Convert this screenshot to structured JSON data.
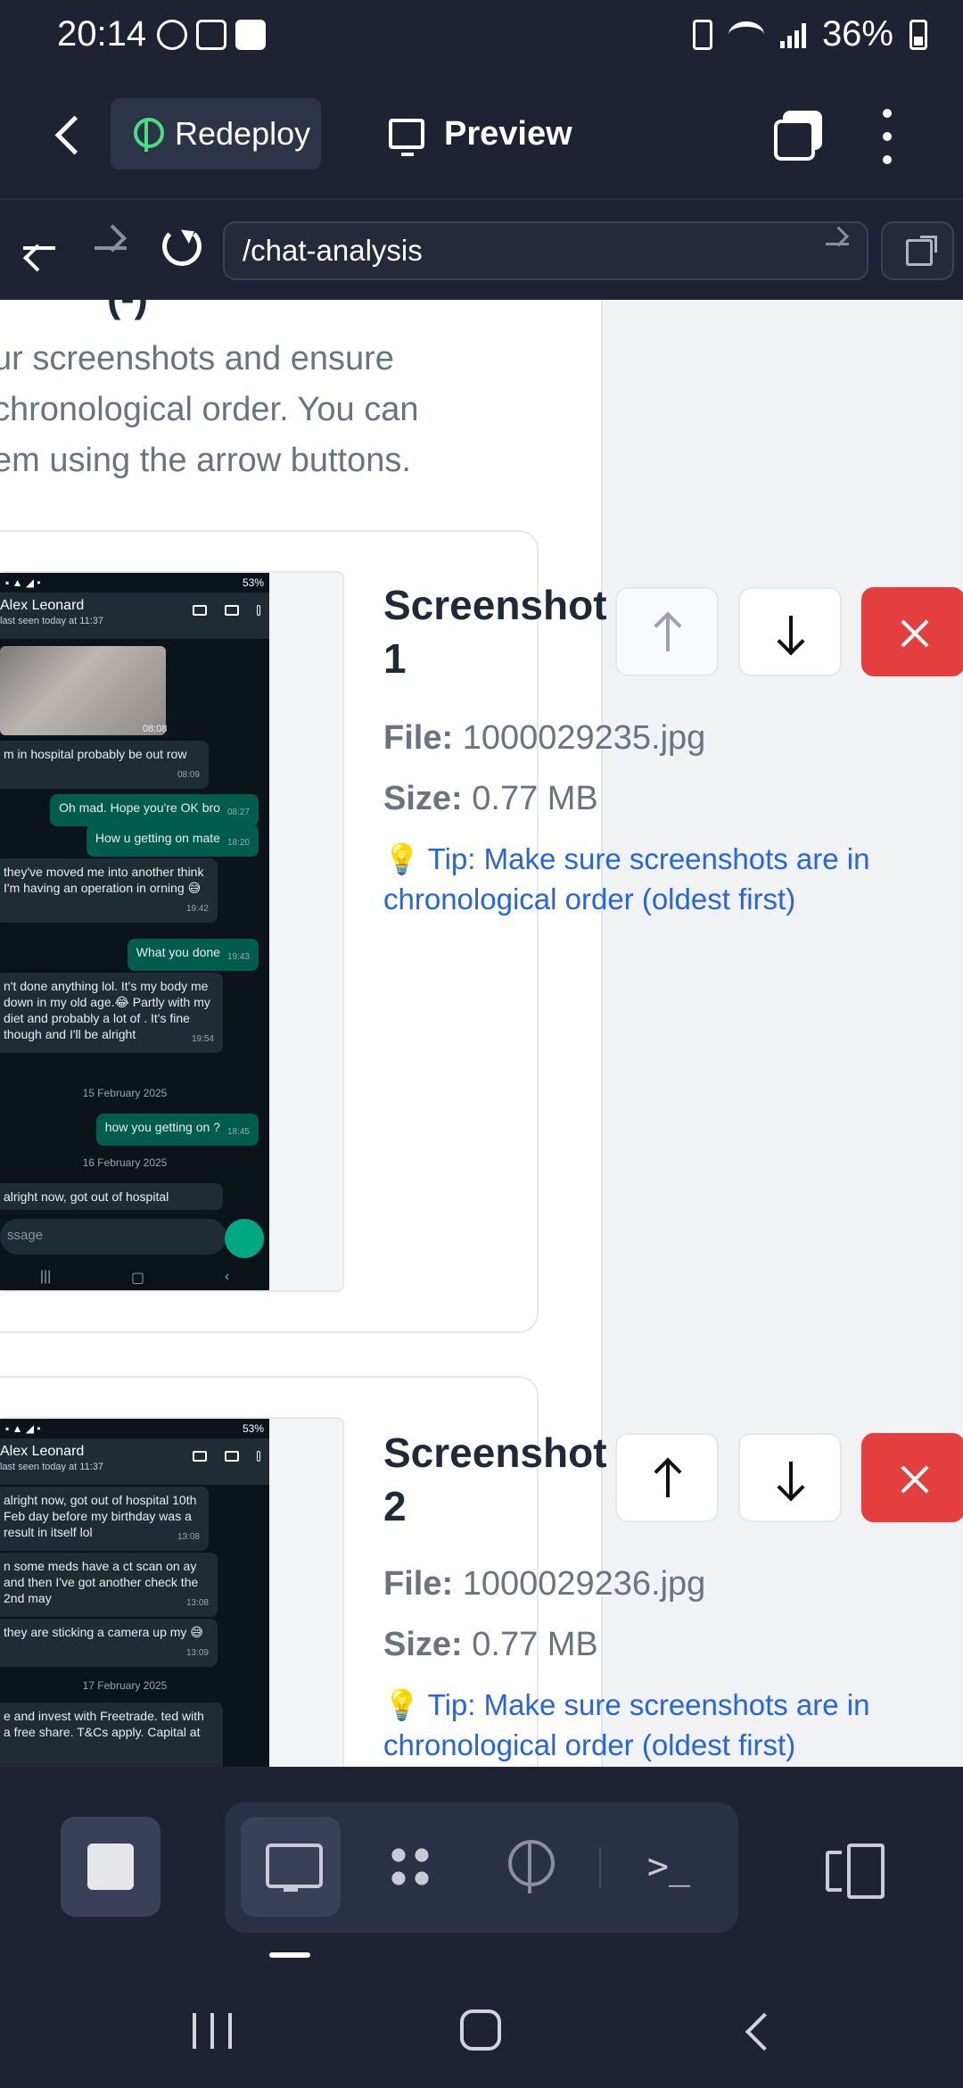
{
  "status_bar": {
    "time": "20:14",
    "battery_percent": "36%"
  },
  "header": {
    "redeploy_label": "Redeploy",
    "preview_label": "Preview"
  },
  "url_bar": {
    "url": "/chat-analysis"
  },
  "page": {
    "intro_lines": [
      "ur screenshots and ensure",
      "chronological order. You can",
      "em using the arrow buttons."
    ],
    "cut_heading": "(-)"
  },
  "screenshots": [
    {
      "title_line1": "Screenshot",
      "title_line2": "1",
      "file_label": "File:",
      "file_name": "1000029235.jpg",
      "size_label": "Size:",
      "size_value": "0.77 MB",
      "tip": "💡 Tip: Make sure screenshots are in chronological order (oldest first)",
      "up_disabled": true
    },
    {
      "title_line1": "Screenshot",
      "title_line2": "2",
      "file_label": "File:",
      "file_name": "1000029236.jpg",
      "size_label": "Size:",
      "size_value": "0.77 MB",
      "tip": "💡 Tip: Make sure screenshots are in chronological order (oldest first)",
      "up_disabled": false
    }
  ],
  "thumb1": {
    "status": "53%",
    "contact": "Alex Leonard",
    "seen": "last seen today at 11:37",
    "photo_time": "08:08",
    "messages": [
      {
        "dir": "in",
        "text": "m in hospital probably be out row",
        "time": "08:09"
      },
      {
        "dir": "out",
        "text": "Oh mad. Hope you're OK bro",
        "time": "08:27"
      },
      {
        "dir": "out",
        "text": "How u getting on mate",
        "time": "18:20"
      },
      {
        "dir": "in",
        "text": "they've moved me into another think I'm having an operation in orning 😅",
        "time": "19:42"
      },
      {
        "dir": "out",
        "text": "What you done",
        "time": "19:43"
      },
      {
        "dir": "in",
        "text": "n't done anything lol. It's my body me down in my old age.😂 Partly with my diet and probably a lot of . It's fine though and I'll be alright",
        "time": "19:54"
      },
      {
        "dir": "out",
        "text": "how you getting on ?",
        "time": "18:45"
      },
      {
        "dir": "in",
        "text": "alright now, got out of hospital",
        "time": ""
      }
    ],
    "dates": [
      "15 February 2025",
      "16 February 2025"
    ],
    "input_placeholder": "ssage"
  },
  "thumb2": {
    "status": "53%",
    "contact": "Alex Leonard",
    "seen": "last seen today at 11:37",
    "messages": [
      {
        "dir": "in",
        "text": "alright now, got out of hospital 10th Feb day before my birthday was a result in itself lol",
        "time": "13:08"
      },
      {
        "dir": "in",
        "text": "n some meds have a ct scan on ay and then I've got another check the 2nd may",
        "time": "13:08"
      },
      {
        "dir": "in",
        "text": "they are sticking a camera up my 😅",
        "time": "13:09"
      },
      {
        "dir": "in",
        "text": "e and invest with Freetrade. ted with a free share. T&Cs apply. Capital at",
        "time": ""
      }
    ],
    "date": "17 February 2025"
  },
  "toolbar": {
    "terminal_glyph": ">_"
  },
  "icons": {
    "redeploy": "deploy-icon",
    "preview": "monitor-icon",
    "tabs": "tabs-icon",
    "more": "more-vert-icon",
    "external": "external-link-icon"
  },
  "colors": {
    "app_bg": "#1e2233",
    "accent_green": "#4ade80",
    "danger": "#e53e3e",
    "tip_blue": "#2563eb"
  }
}
